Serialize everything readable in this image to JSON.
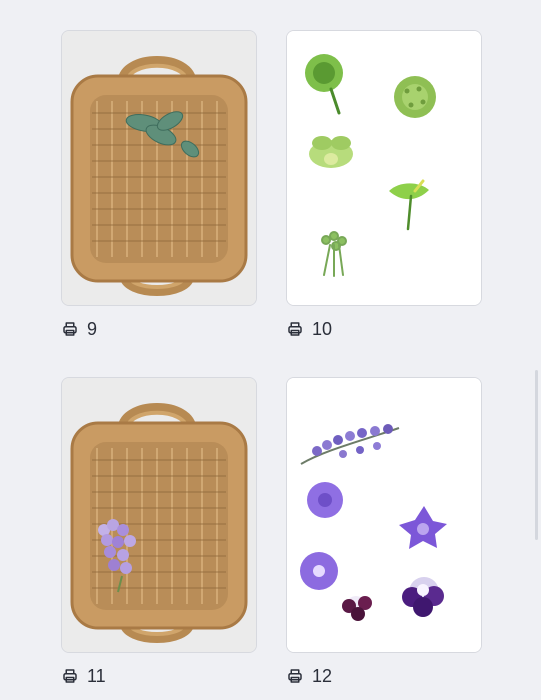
{
  "grid": {
    "items": [
      {
        "label": "9",
        "image": "basket-with-green-leaves",
        "icon": "printer-icon"
      },
      {
        "label": "10",
        "image": "green-flowers-cutouts",
        "icon": "printer-icon"
      },
      {
        "label": "11",
        "image": "basket-with-lilac-sprig",
        "icon": "printer-icon"
      },
      {
        "label": "12",
        "image": "purple-flowers-cutouts",
        "icon": "printer-icon"
      }
    ]
  },
  "colors": {
    "background": "#eff0f4",
    "text": "#2b2f3a",
    "card_border": "#d7d9df"
  }
}
